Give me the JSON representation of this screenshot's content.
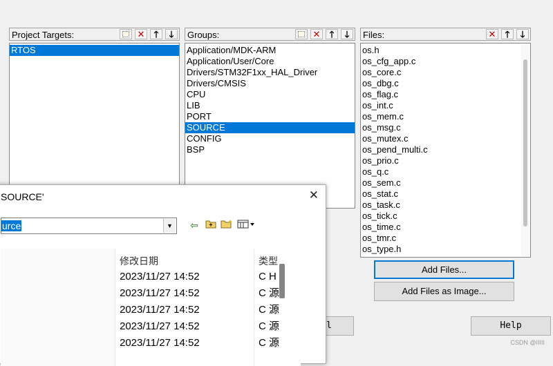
{
  "project_targets": {
    "header": "Project Targets:",
    "items": [
      "RTOS"
    ],
    "selected_index": 0
  },
  "groups": {
    "header": "Groups:",
    "items": [
      "Application/MDK-ARM",
      "Application/User/Core",
      "Drivers/STM32F1xx_HAL_Driver",
      "Drivers/CMSIS",
      "CPU",
      "LIB",
      "PORT",
      "SOURCE",
      "CONFIG",
      "BSP"
    ],
    "selected_index": 7
  },
  "files": {
    "header": "Files:",
    "items": [
      "os.h",
      "os_cfg_app.c",
      "os_core.c",
      "os_dbg.c",
      "os_flag.c",
      "os_int.c",
      "os_mem.c",
      "os_msg.c",
      "os_mutex.c",
      "os_pend_multi.c",
      "os_prio.c",
      "os_q.c",
      "os_sem.c",
      "os_stat.c",
      "os_task.c",
      "os_tick.c",
      "os_time.c",
      "os_tmr.c",
      "os_type.h"
    ]
  },
  "buttons": {
    "add_files": "Add Files...",
    "add_files_as_image": "Add Files as Image...",
    "partial_left": "l",
    "help": "Help"
  },
  "dialog": {
    "title": "SOURCE'",
    "close": "✕",
    "look_in_value": "urce",
    "columns": {
      "sort_arrow": "^",
      "date_modified": "修改日期",
      "type": "类型"
    },
    "rows": [
      {
        "date": "2023/11/27 14:52",
        "type": "C H"
      },
      {
        "date": "2023/11/27 14:52",
        "type": "C 源"
      },
      {
        "date": "2023/11/27 14:52",
        "type": "C 源"
      },
      {
        "date": "2023/11/27 14:52",
        "type": "C 源"
      },
      {
        "date": "2023/11/27 14:52",
        "type": "C 源"
      }
    ]
  },
  "watermark": "CSDN @IIIII",
  "colors": {
    "selection": "#0078d7",
    "delete": "#c00000"
  }
}
